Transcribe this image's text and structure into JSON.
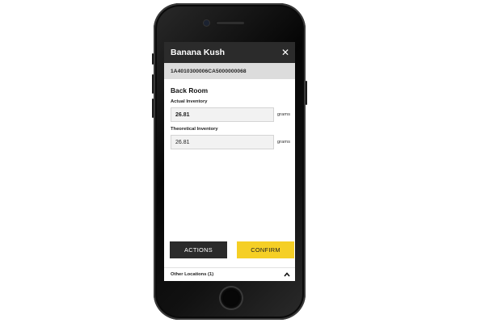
{
  "header": {
    "title": "Banana Kush",
    "close_glyph": "✕"
  },
  "package": {
    "tag": "1A4010300006CA5000000068"
  },
  "room": {
    "name": "Back Room"
  },
  "actual_inventory": {
    "label": "Actual Inventory",
    "value": "26.81",
    "unit": "grams"
  },
  "theoretical_inventory": {
    "label": "Theoretical Inventory",
    "value": "26.81",
    "unit": "grams"
  },
  "buttons": {
    "actions_label": "ACTIONS",
    "confirm_label": "CONFIRM"
  },
  "footer": {
    "other_locations_label": "Other Locations (1)",
    "toggle_icon": "chevron-up-icon"
  },
  "colors": {
    "header_bg": "#2b2b2b",
    "confirm_bg": "#f5cf25",
    "tag_bar_bg": "#dcdcdc"
  }
}
